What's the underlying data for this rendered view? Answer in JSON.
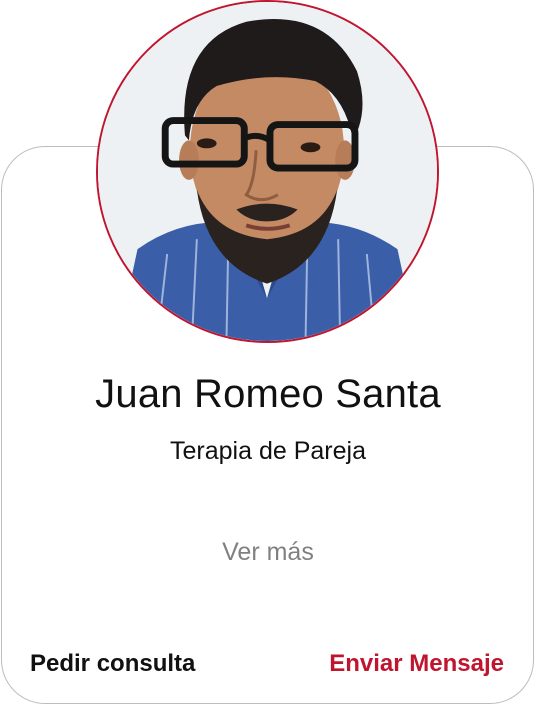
{
  "profile": {
    "name": "Juan Romeo Santa",
    "specialty": "Terapia de Pareja",
    "more_label": "Ver más"
  },
  "actions": {
    "consult_label": "Pedir consulta",
    "message_label": "Enviar Mensaje"
  },
  "colors": {
    "accent": "#c0152f",
    "text": "#111111",
    "muted": "#808080",
    "border": "#bdbdbd"
  }
}
